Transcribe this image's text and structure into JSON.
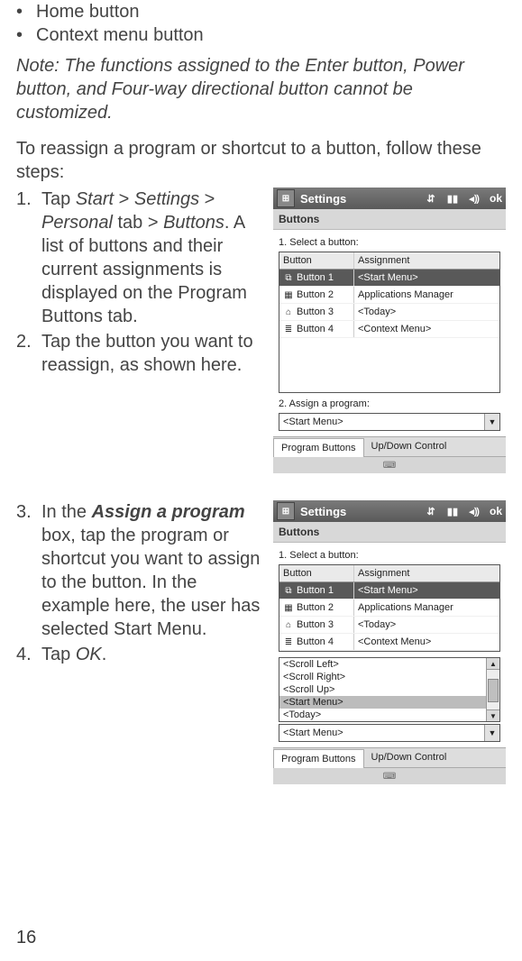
{
  "page_number": "16",
  "bullets": [
    "Home button",
    "Context menu button"
  ],
  "note": "Note: The functions assigned to the Enter button, Power button, and Four-way directional button cannot be customized.",
  "intro": "To reassign a program or shortcut to a button, follow these steps:",
  "steps_a": [
    {
      "num": "1.",
      "segments": [
        {
          "t": "Tap "
        },
        {
          "t": "Start ",
          "cls": "i"
        },
        {
          "t": " > "
        },
        {
          "t": "Settings",
          "cls": "i"
        },
        {
          "t": " > "
        },
        {
          "t": "Personal",
          "cls": "i"
        },
        {
          "t": " tab > "
        },
        {
          "t": "Buttons",
          "cls": "i"
        },
        {
          "t": ". A list of buttons and their current assignments is displayed on the Program Buttons tab."
        }
      ]
    },
    {
      "num": "2.",
      "segments": [
        {
          "t": "Tap the button you want to reassign, as shown here."
        }
      ]
    }
  ],
  "steps_b": [
    {
      "num": "3.",
      "segments": [
        {
          "t": "In the "
        },
        {
          "t": "Assign a program",
          "cls": "b i"
        },
        {
          "t": " box, tap the program or shortcut you want to assign to the button. In the example here, the user has selected Start Menu."
        }
      ]
    },
    {
      "num": "4.",
      "segments": [
        {
          "t": "Tap "
        },
        {
          "t": "OK",
          "cls": "i"
        },
        {
          "t": "."
        }
      ]
    }
  ],
  "screenshot1": {
    "title": "Settings",
    "ok": "ok",
    "panel_header": "Buttons",
    "caption_select": "1. Select a button:",
    "col_button": "Button",
    "col_assignment": "Assignment",
    "rows": [
      {
        "icon": "⧉",
        "name": "Button 1",
        "assign": "<Start Menu>",
        "sel": true
      },
      {
        "icon": "▦",
        "name": "Button 2",
        "assign": "Applications Manager"
      },
      {
        "icon": "⌂",
        "name": "Button 3",
        "assign": "<Today>"
      },
      {
        "icon": "≣",
        "name": "Button 4",
        "assign": "<Context Menu>"
      }
    ],
    "caption_assign": "2. Assign a program:",
    "combo_value": "<Start Menu>",
    "tab1": "Program Buttons",
    "tab2": "Up/Down Control"
  },
  "screenshot2": {
    "title": "Settings",
    "ok": "ok",
    "panel_header": "Buttons",
    "caption_select": "1. Select a button:",
    "col_button": "Button",
    "col_assignment": "Assignment",
    "rows": [
      {
        "icon": "⧉",
        "name": "Button 1",
        "assign": "<Start Menu>",
        "sel": true
      },
      {
        "icon": "▦",
        "name": "Button 2",
        "assign": "Applications Manager"
      },
      {
        "icon": "⌂",
        "name": "Button 3",
        "assign": "<Today>"
      },
      {
        "icon": "≣",
        "name": "Button 4",
        "assign": "<Context Menu>"
      }
    ],
    "droplist": [
      {
        "t": "<Scroll Left>"
      },
      {
        "t": "<Scroll Right>"
      },
      {
        "t": "<Scroll Up>"
      },
      {
        "t": "<Start Menu>",
        "hl": true
      },
      {
        "t": "<Today>"
      }
    ],
    "combo_value": "<Start Menu>",
    "tab1": "Program Buttons",
    "tab2": "Up/Down Control"
  }
}
